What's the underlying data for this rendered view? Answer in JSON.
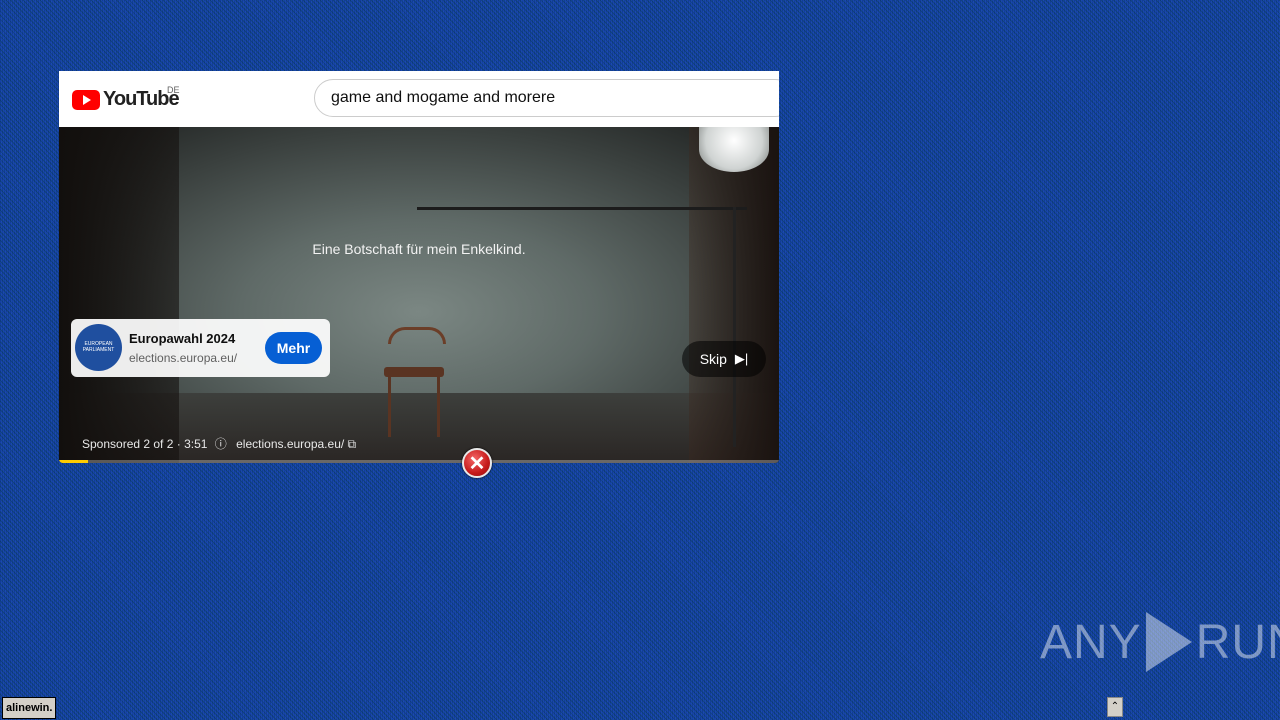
{
  "youtube": {
    "logo_text": "YouTube",
    "region": "DE",
    "search_value": "game and mogame and morere"
  },
  "video": {
    "caption": "Eine Botschaft für mein Enkelkind.",
    "progress_fraction": 0.04
  },
  "ad": {
    "logo_text": "EUROPEAN PARLIAMENT",
    "title": "Europawahl 2024",
    "url": "elections.europa.eu/",
    "cta_label": "Mehr",
    "skip_label": "Skip",
    "skip_icon": "▶|",
    "sponsored_text": "Sponsored 2 of 2 · 3:51",
    "info_icon": "ⓘ",
    "footer_url": "elections.europa.eu/",
    "external_icon": "⧉"
  },
  "overlay": {
    "close_icon": "✕"
  },
  "watermark": {
    "left": "ANY",
    "right": "RUN"
  },
  "taskbar": {
    "label": "alinewin.",
    "tray_icon": "⌃"
  }
}
